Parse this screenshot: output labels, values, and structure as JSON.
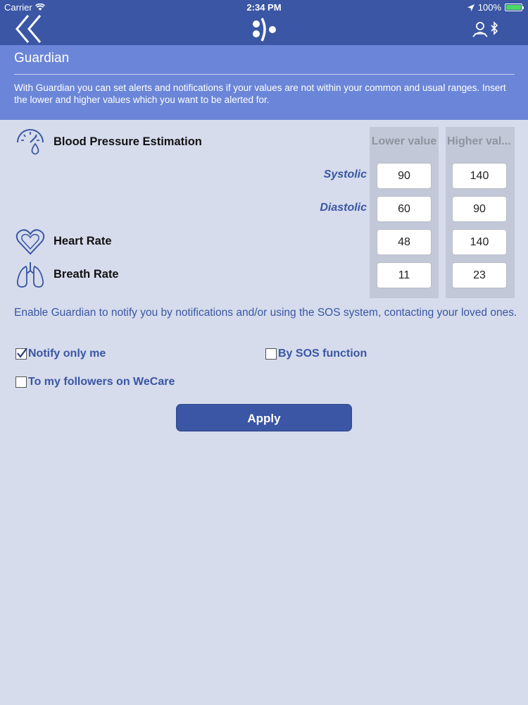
{
  "status_bar": {
    "carrier": "Carrier",
    "time": "2:34 PM",
    "battery": "100%"
  },
  "nav": {
    "back_icon": "double-chevron-left-icon",
    "logo_icon": "app-logo-icon",
    "right_icon": "user-bluetooth-icon"
  },
  "guardian": {
    "title": "Guardian",
    "description": "With Guardian you can set alerts and notifications if your values are not within your common and usual ranges. Insert the lower and higher values which you want to be alerted for."
  },
  "table": {
    "lower_header": "Lower value",
    "higher_header": "Higher val..."
  },
  "metrics": {
    "blood_pressure": {
      "label": "Blood Pressure Estimation",
      "systolic_label": "Systolic",
      "systolic_lower": "90",
      "systolic_higher": "140",
      "diastolic_label": "Diastolic",
      "diastolic_lower": "60",
      "diastolic_higher": "90"
    },
    "heart_rate": {
      "label": "Heart Rate",
      "lower": "48",
      "higher": "140"
    },
    "breath_rate": {
      "label": "Breath Rate",
      "lower": "11",
      "higher": "23"
    }
  },
  "notify": {
    "description": "Enable Guardian to notify you by notifications and/or using the SOS system, contacting your loved ones.",
    "notify_me_label": "Notify only me",
    "notify_me_checked": true,
    "sos_label": "By SOS function",
    "sos_checked": false,
    "followers_label": "To my followers on WeCare",
    "followers_checked": false
  },
  "apply_label": "Apply",
  "colors": {
    "primary": "#3a56a4",
    "panel": "#6b86d8",
    "background": "#d6dcec"
  }
}
